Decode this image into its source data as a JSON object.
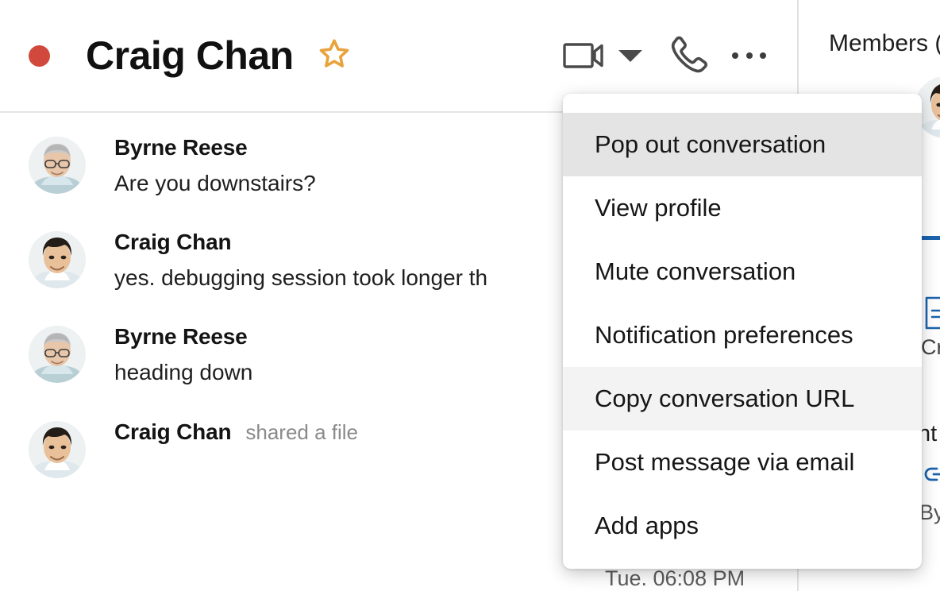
{
  "header": {
    "presence": "online-busy",
    "presence_color": "#d1493d",
    "title": "Craig Chan",
    "star_color": "#e8a33d",
    "star_icon": "star-outline-icon",
    "actions": [
      {
        "name": "video-call-button",
        "icon": "video-camera-icon"
      },
      {
        "name": "video-options-button",
        "icon": "chevron-down-icon"
      },
      {
        "name": "audio-call-button",
        "icon": "phone-icon"
      },
      {
        "name": "more-options-button",
        "icon": "three-dots-vertical-icon"
      }
    ]
  },
  "messages": [
    {
      "author": "Byrne Reese",
      "meta": "",
      "text": "Are you downstairs?",
      "avatar": "byrne"
    },
    {
      "author": "Craig Chan",
      "meta": "",
      "text": "yes. debugging session took longer th",
      "avatar": "craig"
    },
    {
      "author": "Byrne Reese",
      "meta": "",
      "text": "heading down",
      "avatar": "byrne"
    },
    {
      "author": "Craig Chan",
      "meta": "shared a file",
      "text": "",
      "avatar": "craig"
    }
  ],
  "footer": {
    "timestamp": "Tue. 06:08 PM"
  },
  "context_menu": {
    "items": [
      {
        "label": "Pop out conversation",
        "highlight": "strong"
      },
      {
        "label": "View profile",
        "highlight": "none"
      },
      {
        "label": "Mute conversation",
        "highlight": "none"
      },
      {
        "label": "Notification preferences",
        "highlight": "none"
      },
      {
        "label": "Copy conversation URL",
        "highlight": "soft"
      },
      {
        "label": "Post message via email",
        "highlight": "none"
      },
      {
        "label": "Add apps",
        "highlight": "none"
      }
    ]
  },
  "right_panel": {
    "title": "Members (",
    "tab_accent_color": "#1b63ad",
    "fragment_1": "Cr",
    "fragment_2": "nt",
    "fragment_3": "By",
    "file_icon": "document-icon",
    "link_icon": "link-chain-icon"
  }
}
